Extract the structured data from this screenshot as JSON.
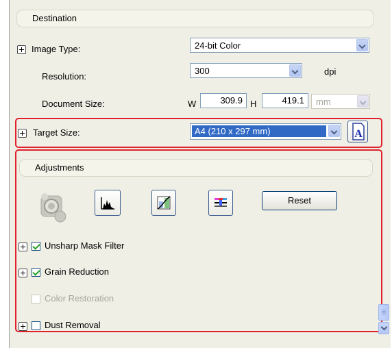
{
  "destination": {
    "header": "Destination",
    "image_type_label": "Image Type:",
    "image_type_value": "24-bit Color",
    "resolution_label": "Resolution:",
    "resolution_value": "300",
    "resolution_unit": "dpi",
    "doc_size_label": "Document Size:",
    "w_label": "W",
    "width_value": "309.9",
    "h_label": "H",
    "height_value": "419.1",
    "unit_value": "mm",
    "target_size_label": "Target Size:",
    "target_size_value": "A4 (210 x 297 mm)"
  },
  "adjustments": {
    "header": "Adjustments",
    "reset_label": "Reset",
    "options": [
      {
        "label": "Unsharp Mask Filter",
        "checked": true,
        "enabled": true
      },
      {
        "label": "Grain Reduction",
        "checked": true,
        "enabled": true
      },
      {
        "label": "Color Restoration",
        "checked": false,
        "enabled": false
      },
      {
        "label": "Dust Removal",
        "checked": false,
        "enabled": true
      }
    ]
  },
  "icons": [
    "auto-exposure-icon",
    "histogram-icon",
    "tone-correction-icon",
    "color-palette-icon",
    "orientation-a-icon"
  ],
  "colors": {
    "highlight": "#e0202a",
    "selection": "#316ac5",
    "panel": "#f0efe6"
  }
}
